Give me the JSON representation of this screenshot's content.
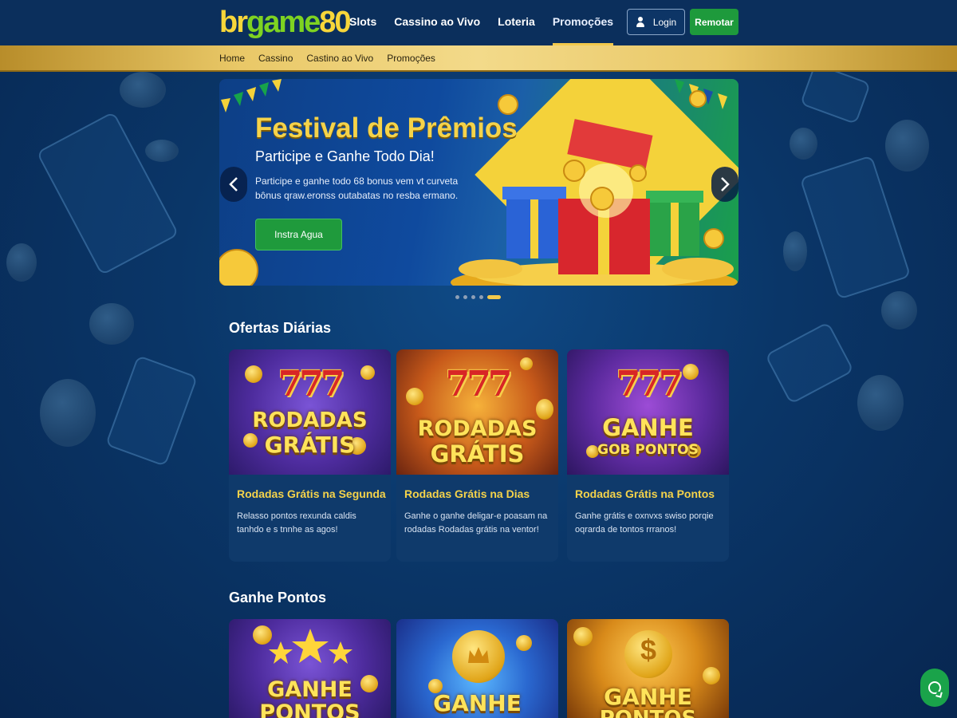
{
  "colors": {
    "brand_yellow": "#f7d63a",
    "brand_green": "#7ed321",
    "cta_green": "#1e9a3c",
    "gold_bar": "#e9c867",
    "bg_blue": "#0a3668"
  },
  "header": {
    "logo": {
      "part1": "br",
      "part2": "game",
      "part3": "80"
    },
    "nav": [
      {
        "label": "Slots"
      },
      {
        "label": "Cassino ao Vivo"
      },
      {
        "label": "Loteria"
      },
      {
        "label": "Promoções",
        "active": true
      }
    ],
    "login_label": "Login",
    "register_label": "Remotar",
    "login_icon": "user-icon"
  },
  "subnav": [
    "Home",
    "Cassino",
    "Castino ao Vivo",
    "Promoções"
  ],
  "hero": {
    "title": "Festival de Prêmios",
    "subtitle": "Participe e Ganhe Todo Dia!",
    "description": "Participe e ganhe todo 68 bonus vem vt curveta bônus qraw.eronss outabatas no resba ermano.",
    "cta_label": "Instra Agua",
    "prev_icon": "chevron-left-icon",
    "next_icon": "chevron-right-icon",
    "slide_count": 5,
    "active_slide": 5
  },
  "section_daily": {
    "title": "Ofertas Diárias",
    "cards": [
      {
        "image_line1": "RODADAS",
        "image_line2": "GRÁTIS",
        "title": "Rodadas Grátis na Segunda",
        "description": "Relasso pontos rexunda caldis tanhdo e s tnnhe as agos!"
      },
      {
        "image_line1": "RODADAS",
        "image_line2": "GRÁTIS",
        "title": "Rodadas Grátis na Dias",
        "description": "Ganhe o ganhe deligar-e poasam na rodadas Rodadas grátis na ventor!"
      },
      {
        "image_line1": "GANHE",
        "image_line2": "GOB PONTOS",
        "title": "Rodadas Grátis na Pontos",
        "description": "Ganhe grátis e oxnvxs swiso porqie oqrarda de tontos rrranos!"
      }
    ]
  },
  "section_points": {
    "title": "Ganhe Pontos",
    "cards": [
      {
        "image_line1": "GANHE",
        "image_line2": "PONTOS"
      },
      {
        "image_line1": "GANHE"
      },
      {
        "image_line1": "GANHE",
        "image_line2": "PONTOS"
      }
    ]
  },
  "chat": {
    "icon": "chat-icon"
  }
}
